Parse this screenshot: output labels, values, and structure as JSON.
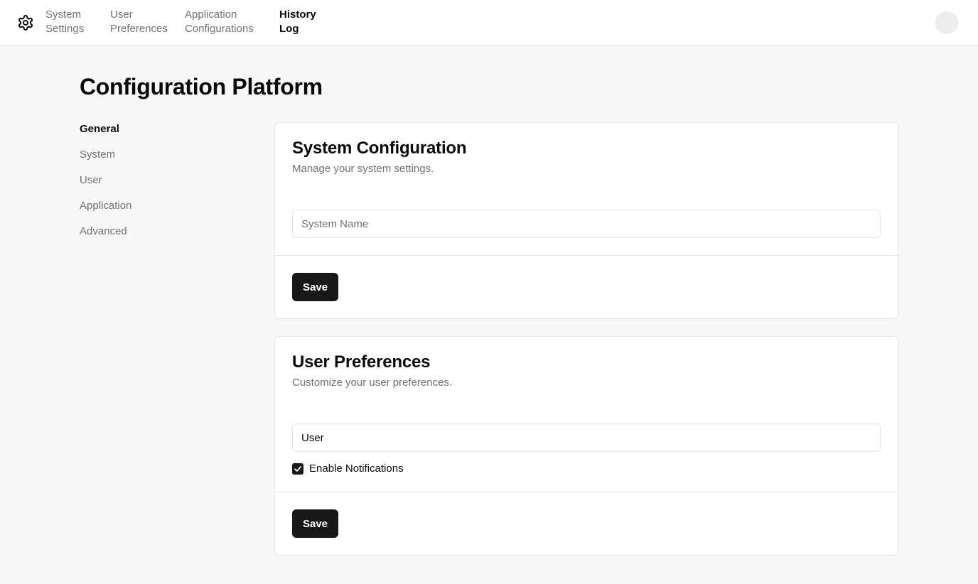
{
  "nav": {
    "links": [
      {
        "line1": "System",
        "line2": "Settings"
      },
      {
        "line1": "User",
        "line2": "Preferences"
      },
      {
        "line1": "Application",
        "line2": "Configurations"
      },
      {
        "line1": "History",
        "line2": "Log"
      }
    ],
    "active_index": 3,
    "logo_icon": "gear-icon"
  },
  "page": {
    "title": "Configuration Platform"
  },
  "sidebar": {
    "items": [
      {
        "label": "General",
        "active": true
      },
      {
        "label": "System",
        "active": false
      },
      {
        "label": "User",
        "active": false
      },
      {
        "label": "Application",
        "active": false
      },
      {
        "label": "Advanced",
        "active": false
      }
    ]
  },
  "system_card": {
    "title": "System Configuration",
    "description": "Manage your system settings.",
    "input_placeholder": "System Name",
    "input_value": "",
    "save_label": "Save"
  },
  "user_card": {
    "title": "User Preferences",
    "description": "Customize your user preferences.",
    "input_value": "User",
    "checkbox_label": "Enable Notifications",
    "checkbox_checked": true,
    "save_label": "Save"
  },
  "colors": {
    "page_bg": "#f7f7f6",
    "primary": "#18181b",
    "muted_text": "#71717a",
    "border": "#e5e5e5"
  }
}
